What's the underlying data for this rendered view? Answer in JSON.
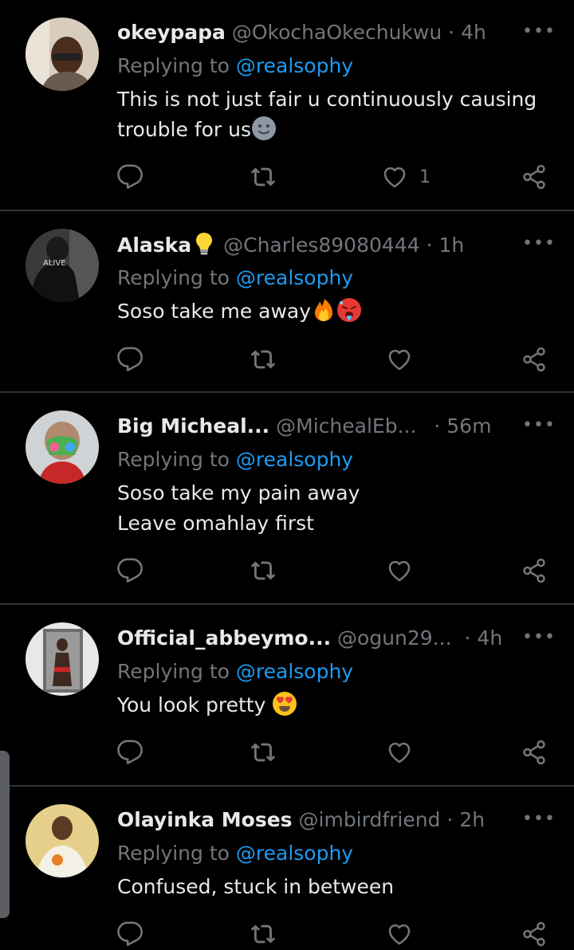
{
  "replies": [
    {
      "name": "okeypapa",
      "name_emoji": "",
      "handle": "@OkochaOkechukwu",
      "time": "4h",
      "replying_label": "Replying to ",
      "mention": "@realsophy",
      "text": "This is not just fair u continuously causing\ntrouble for us",
      "text_emoji": [
        "slightly-smiling-face-emoji"
      ],
      "like_count": "1"
    },
    {
      "name": "Alaska",
      "name_emoji": "light-bulb-emoji",
      "handle": "@Charles89080444",
      "time": "1h",
      "replying_label": "Replying to ",
      "mention": "@realsophy",
      "text": "Soso take me away",
      "text_emoji": [
        "fire-emoji",
        "hot-face-emoji"
      ],
      "like_count": ""
    },
    {
      "name": "Big Micheal...",
      "name_emoji": "",
      "handle": "@MichealEb...",
      "time": "56m",
      "replying_label": "Replying to ",
      "mention": "@realsophy",
      "text": "Soso take my pain away\nLeave omahlay first",
      "text_emoji": [],
      "like_count": ""
    },
    {
      "name": "Official_abbeymo...",
      "name_emoji": "",
      "handle": "@ogun29...",
      "time": "4h",
      "replying_label": "Replying to ",
      "mention": "@realsophy",
      "text": "You look pretty ",
      "text_emoji": [
        "heart-eyes-emoji"
      ],
      "like_count": ""
    },
    {
      "name": "Olayinka Moses",
      "name_emoji": "",
      "handle": "@imbirdfriend",
      "time": "2h",
      "replying_label": "Replying to ",
      "mention": "@realsophy",
      "text": "Confused, stuck in between",
      "text_emoji": [],
      "like_count": ""
    }
  ],
  "separator": "·",
  "more_glyph": "•••",
  "colors": {
    "background": "#000000",
    "text": "#e7e9ea",
    "muted": "#71767b",
    "accent": "#1d9bf0",
    "divider": "#2f3336"
  },
  "icons": [
    "reply-icon",
    "retweet-icon",
    "like-icon",
    "share-icon",
    "more-icon"
  ]
}
